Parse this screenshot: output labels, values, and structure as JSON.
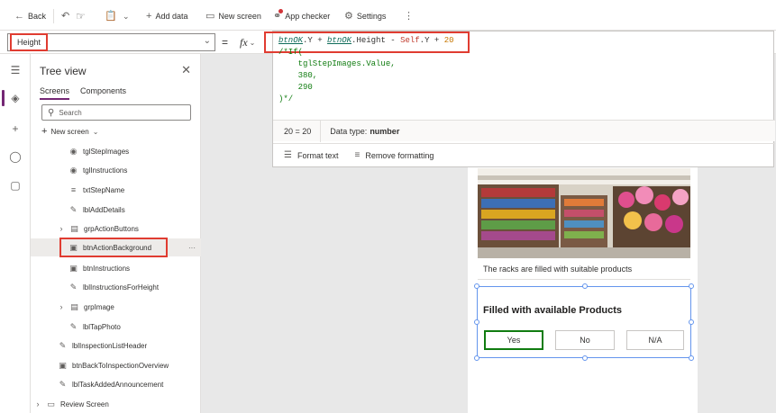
{
  "toolbar": {
    "back": "Back",
    "add_data": "Add data",
    "new_screen": "New screen",
    "app_checker": "App checker",
    "settings": "Settings"
  },
  "property": {
    "name": "Height",
    "equals": "="
  },
  "formula": {
    "ref1": "btnOK",
    "part1": ".Y + ",
    "ref2": "btnOK",
    "part2": ".Height - ",
    "self": "Self",
    "part3": ".Y + ",
    "num": "20",
    "comment": "/*If(\n    tglStepImages.Value,\n    380,\n    290\n)*/",
    "eval_result": "20  =  20",
    "data_type_label": "Data type:",
    "data_type_value": "number",
    "format_text": "Format text",
    "remove_formatting": "Remove formatting"
  },
  "tree": {
    "title": "Tree view",
    "tabs": [
      "Screens",
      "Components"
    ],
    "search_placeholder": "Search",
    "new_screen": "New screen",
    "nodes": [
      {
        "label": "tglStepImages"
      },
      {
        "label": "tglInstructions"
      },
      {
        "label": "txtStepName"
      },
      {
        "label": "lblAddDetails"
      },
      {
        "label": "grpActionButtons"
      },
      {
        "label": "btnActionBackground"
      },
      {
        "label": "btnInstructions"
      },
      {
        "label": "lblInstructionsForHeight"
      },
      {
        "label": "grpImage"
      },
      {
        "label": "lblTapPhoto"
      },
      {
        "label": "lblInspectionListHeader"
      },
      {
        "label": "btnBackToInspectionOverview"
      },
      {
        "label": "lblTaskAddedAnnouncement"
      },
      {
        "label": "Review Screen"
      }
    ],
    "more": "···"
  },
  "canvas": {
    "caption": "The racks are filled with suitable products",
    "question": "Filled with available Products",
    "answers": [
      "Yes",
      "No",
      "N/A"
    ]
  },
  "colors": {
    "accent": "#742774",
    "highlight": "#e03c31",
    "selection": "#6495ed",
    "yes_border": "#107c10"
  }
}
